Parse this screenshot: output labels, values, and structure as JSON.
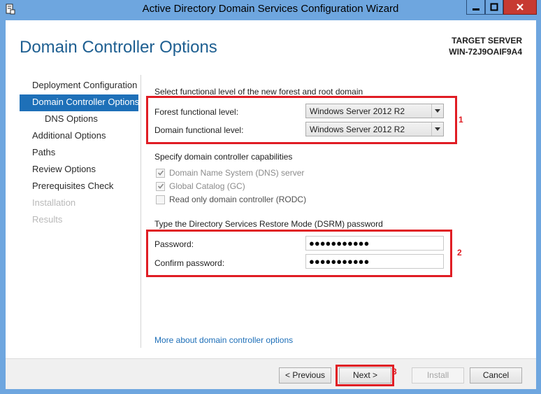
{
  "window": {
    "title": "Active Directory Domain Services Configuration Wizard"
  },
  "header": {
    "page_title": "Domain Controller Options",
    "target_label": "TARGET SERVER",
    "target_name": "WIN-72J9OAIF9A4"
  },
  "nav": {
    "items": [
      {
        "label": "Deployment Configuration",
        "state": "normal"
      },
      {
        "label": "Domain Controller Options",
        "state": "active"
      },
      {
        "label": "DNS Options",
        "state": "sub"
      },
      {
        "label": "Additional Options",
        "state": "normal"
      },
      {
        "label": "Paths",
        "state": "normal"
      },
      {
        "label": "Review Options",
        "state": "normal"
      },
      {
        "label": "Prerequisites Check",
        "state": "normal"
      },
      {
        "label": "Installation",
        "state": "disabled"
      },
      {
        "label": "Results",
        "state": "disabled"
      }
    ]
  },
  "functional": {
    "heading": "Select functional level of the new forest and root domain",
    "forest_label": "Forest functional level:",
    "forest_value": "Windows Server 2012 R2",
    "domain_label": "Domain functional level:",
    "domain_value": "Windows Server 2012 R2"
  },
  "capabilities": {
    "heading": "Specify domain controller capabilities",
    "dns": {
      "label": "Domain Name System (DNS) server",
      "checked": true
    },
    "gc": {
      "label": "Global Catalog (GC)",
      "checked": true
    },
    "rodc": {
      "label": "Read only domain controller (RODC)",
      "checked": false
    }
  },
  "dsrm": {
    "heading": "Type the Directory Services Restore Mode (DSRM) password",
    "password_label": "Password:",
    "password_value": "●●●●●●●●●●●",
    "confirm_label": "Confirm password:",
    "confirm_value": "●●●●●●●●●●●"
  },
  "annotations": {
    "marker1": "1",
    "marker2": "2",
    "marker3": "3",
    "color": "#e01d24"
  },
  "more_link": "More about domain controller options",
  "footer": {
    "previous": "< Previous",
    "next": "Next >",
    "install": "Install",
    "cancel": "Cancel"
  },
  "icons": {
    "app": "server-manager-icon",
    "minimize": "minimize-icon",
    "maximize": "maximize-icon",
    "close": "close-icon"
  }
}
